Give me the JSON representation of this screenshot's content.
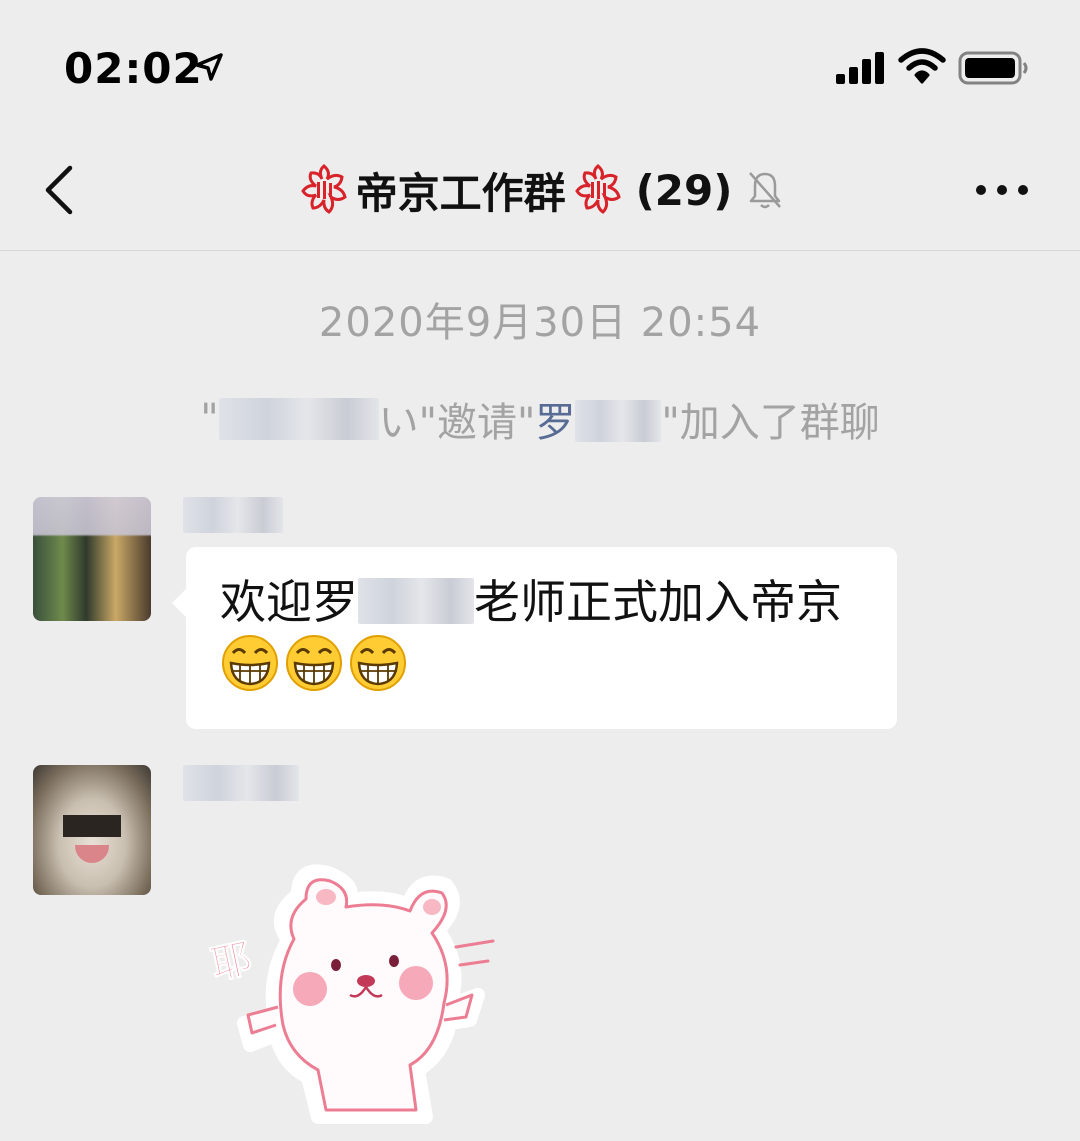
{
  "status_bar": {
    "time": "02:02"
  },
  "nav": {
    "title": "帝京工作群",
    "member_count": "(29)"
  },
  "chat": {
    "timestamp": "2020年9月30日 20:54",
    "system_message": {
      "open_quote": "\"",
      "inviter_suffix": "い",
      "invited_text": "\"邀请\"",
      "invitee_surname": "罗",
      "joined_text": "\"加入了群聊"
    },
    "messages": [
      {
        "text_before": "欢迎罗",
        "text_after": "老师正式加入帝京",
        "emoji": [
          "grin-emoji",
          "grin-emoji",
          "grin-emoji"
        ]
      },
      {
        "sticker_text": "耶"
      }
    ]
  },
  "colors": {
    "background": "#ededed",
    "link": "#576b95",
    "system_text": "#a3a3a3",
    "bubble": "#ffffff"
  }
}
